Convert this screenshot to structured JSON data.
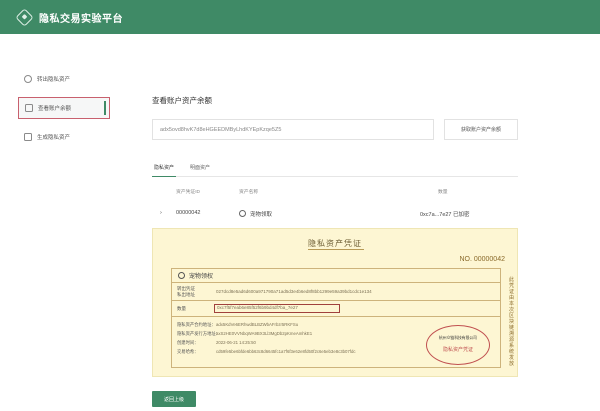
{
  "header": {
    "title": "隐私交易实验平台"
  },
  "sidebar": {
    "items": [
      {
        "label": "转出隐私资产",
        "icon": "transfer-icon"
      },
      {
        "label": "查看账户余额",
        "icon": "wallet-icon",
        "active": true
      },
      {
        "label": "生成隐私资产",
        "icon": "generate-icon"
      }
    ]
  },
  "main": {
    "title": "查看账户资产余额",
    "address": "adx5ovd8hvK7d8eHGEEDMByLhdKYEpKzqe5Z5",
    "query_button": "获取账户资产余额",
    "tabs": [
      {
        "label": "隐私资产",
        "active": true
      },
      {
        "label": "明面资产",
        "active": false
      }
    ],
    "table": {
      "headers": {
        "id": "资产凭证ID",
        "name": "资产名称",
        "amount": "数量"
      },
      "rows": [
        {
          "expand": "›",
          "id": "00000042",
          "name": "宠物领取",
          "amount": "0xc7a...7e27 已加密"
        }
      ]
    },
    "certificate": {
      "title": "隐私资产凭证",
      "number": "NO. 00000042",
      "vertical_note": "此凭证由本次区块链溯源系统发放",
      "asset_name": "宠物领权",
      "sections": {
        "issuer_label": "转出凭证\n私出地址",
        "issuer_value": "027dcd8e5ad6d600a971790a71ad5d3e4b6ed8f8bb1299e59a39bd1cdc1e134",
        "qty_label": "数量",
        "qty_value": "0xc7f5f7eab6e85f52f6b9bd4df7ba_7e27"
      },
      "meta": [
        {
          "label": "隐私资产合约地址：",
          "value": "adx5KdVe6ERhwdBLBZWbAFrbzr5RKFSu"
        },
        {
          "label": "隐私资产发行方地址：",
          "value": "axS2HE0VVNbqWA9BX3Ll3MgDb2pKmeAmhkE1"
        },
        {
          "label": "创建时间：",
          "value": "2022-06-21 14:25:50"
        },
        {
          "label": "交易哈希：",
          "value": "cd59fe5be6bfde6bb63c8d6645fc1a7f6f3e62e8fd50f2c6e5eb3e8c3b07fdc"
        }
      ],
      "seal": {
        "org": "杭州众链科技有限公司",
        "text": "隐私资产凭证"
      }
    },
    "return_button": "返回上级"
  },
  "colors": {
    "brand": "#3f8a66",
    "highlight": "#c8606e",
    "cert_bg": "#fdf6d3"
  }
}
